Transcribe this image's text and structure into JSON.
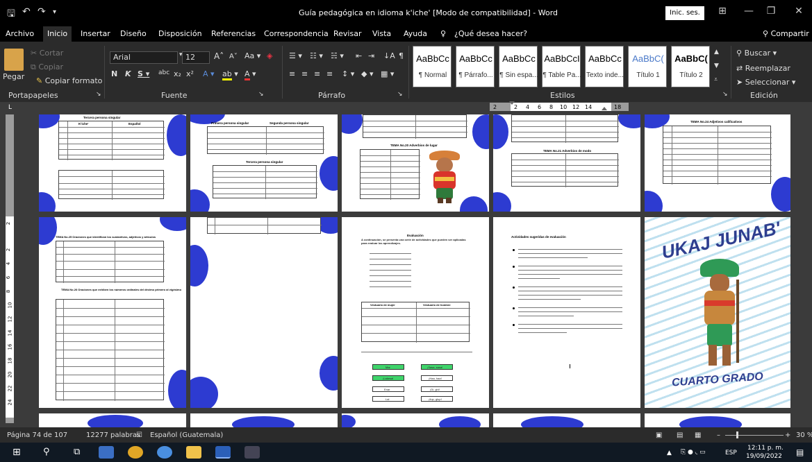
{
  "window": {
    "title": "Guía pedagógica en idioma k'iche' [Modo de compatibilidad]  -  Word",
    "sign_in": "Inic. ses."
  },
  "menu": {
    "items": [
      "Archivo",
      "Inicio",
      "Insertar",
      "Diseño",
      "Disposición",
      "Referencias",
      "Correspondencia",
      "Revisar",
      "Vista",
      "Ayuda"
    ],
    "tell_me": "¿Qué desea hacer?",
    "share": "Compartir"
  },
  "ribbon": {
    "clipboard": {
      "paste": "Pegar",
      "cut": "Cortar",
      "copy": "Copiar",
      "format_painter": "Copiar formato",
      "group": "Portapapeles"
    },
    "font": {
      "name": "Arial",
      "size": "12",
      "group": "Fuente"
    },
    "paragraph": {
      "group": "Párrafo"
    },
    "styles": {
      "group": "Estilos",
      "items": [
        {
          "sample": "AaBbCc",
          "name": "¶ Normal"
        },
        {
          "sample": "AaBbCc",
          "name": "¶ Párrafo..."
        },
        {
          "sample": "AaBbCc",
          "name": "¶ Sin espa..."
        },
        {
          "sample": "AaBbCcI",
          "name": "¶ Table Pa..."
        },
        {
          "sample": "AaBbCc",
          "name": "Texto inde..."
        },
        {
          "sample": "AaBbC(",
          "name": "Título 1"
        },
        {
          "sample": "AaBbC(",
          "name": "Título 2"
        }
      ]
    },
    "editing": {
      "find": "Buscar",
      "replace": "Reemplazar",
      "select": "Seleccionar",
      "group": "Edición"
    }
  },
  "ruler": {
    "labels": [
      "2",
      "2",
      "4",
      "6",
      "8",
      "10",
      "12",
      "14",
      "18"
    ],
    "v_labels": [
      "2",
      "2",
      "4",
      "6",
      "8",
      "10",
      "12",
      "14",
      "16",
      "18",
      "20",
      "22",
      "24"
    ]
  },
  "pages": {
    "p1_title": "Tercera persona singular",
    "p1_head": [
      "K'iche'",
      "Español"
    ],
    "p2_title": "Primera persona singular",
    "p2_title_b": "Segunda persona singular",
    "p2_title_c": "Tercera persona singular",
    "p3_title": "TEMA No.20 Adverbios de lugar",
    "p4_title": "TEMA No.21 Adverbios de modo",
    "p5_title": "TEMA No.24 Adjetivos calificativos",
    "p6_title": "TEMA No.25 Oraciones que identifican los sustantivos, adjetivos y artículos",
    "p6_title_b": "TEMA No.26 Oraciones que exhiben los números ordinales del décimo primero al vigésimo",
    "p8_title": "Evaluación",
    "p8_text": "A continuación, se presenta una serie de actividades que pueden ser aplicadas para evaluar los aprendizajes.",
    "p8_h1": "Vestuario de mujer",
    "p8_h2": "Vestuario de hombre",
    "p8_boxes": [
      "Mar",
      "¡Sasa, sasa!",
      "¡Lakesa!",
      "¡Haa, haa!",
      "Enar",
      "¡Di, ghi!",
      "Lal",
      "¡Ilup, glup!"
    ],
    "p9_title": "Actividades sugeridas de evaluación",
    "p10_top": "UKAJ JUNAB'",
    "p10_bottom": "CUARTO GRADO"
  },
  "status": {
    "page": "Página 74 de 107",
    "words": "12277 palabras",
    "language": "Español (Guatemala)",
    "zoom": "30 %"
  },
  "taskbar": {
    "lang": "ESP",
    "time": "12:11 p. m.",
    "date": "19/09/2022"
  },
  "colors": {
    "accent": "#2d3bd1",
    "ribbon": "#2b2b2b",
    "green": "#3fd46b"
  }
}
